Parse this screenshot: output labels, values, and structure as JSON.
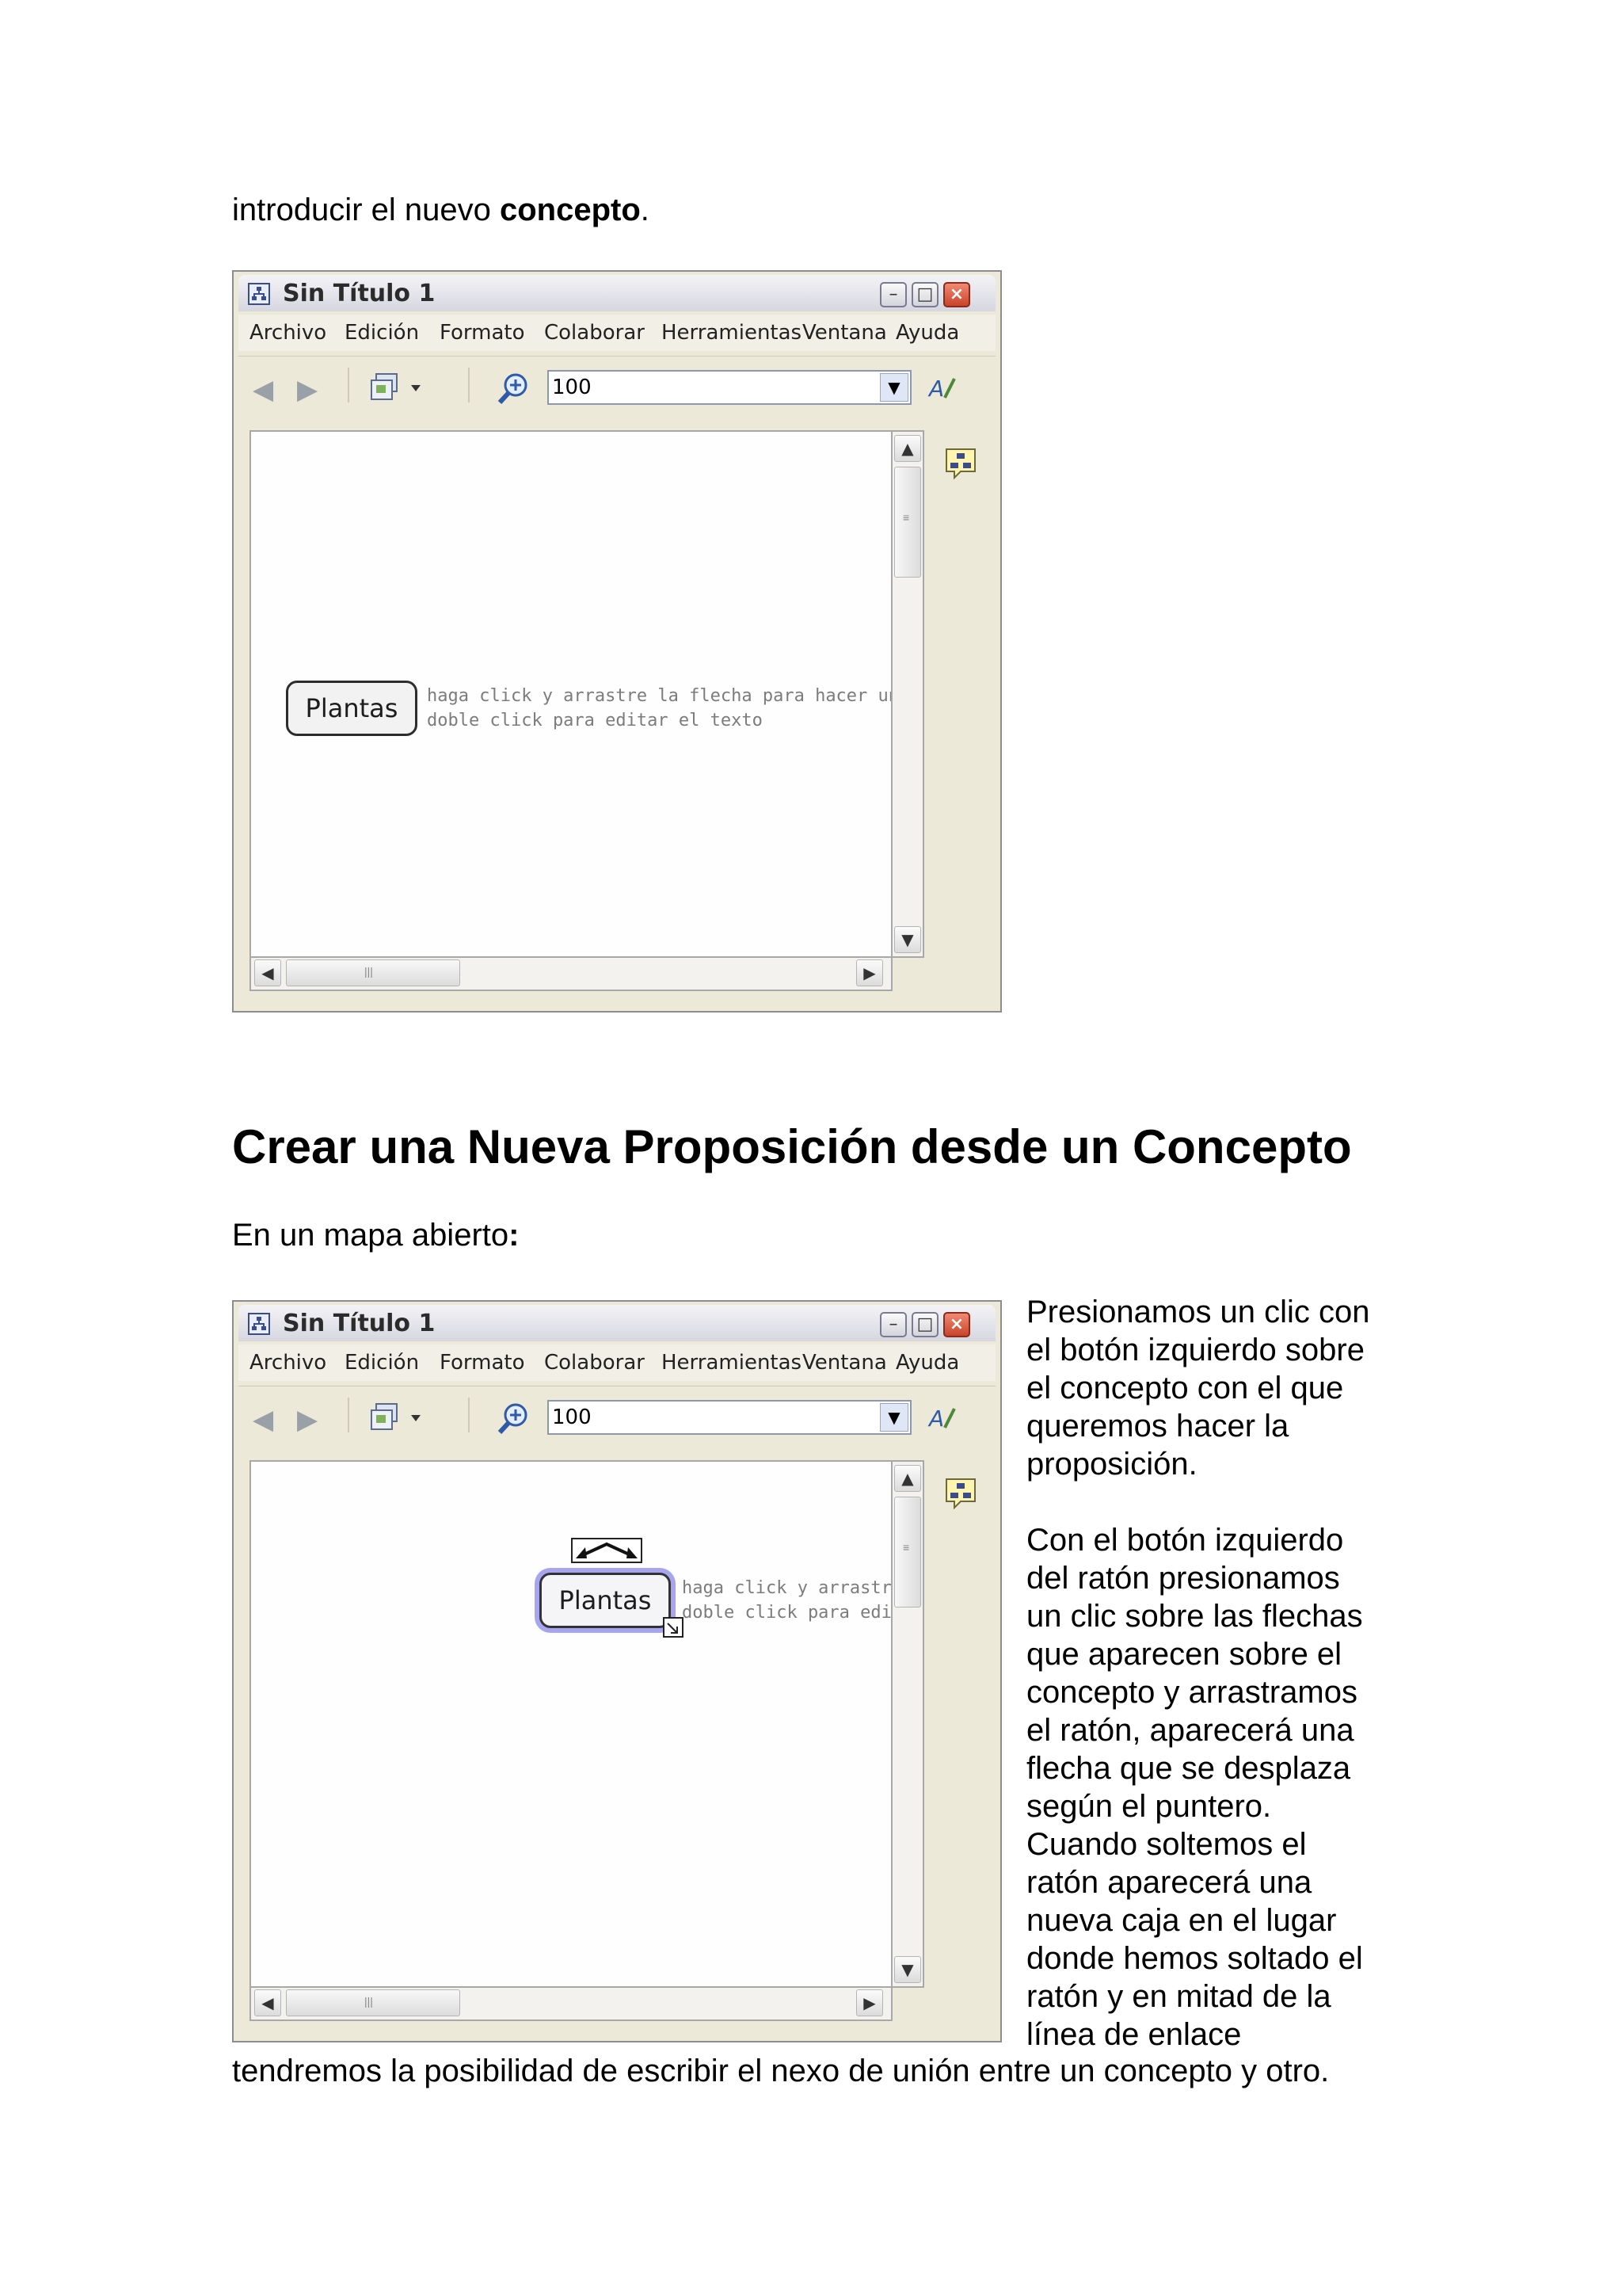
{
  "intro": {
    "text_before": "introducir el nuevo ",
    "bold": "concepto",
    "text_after": "."
  },
  "heading": "Crear una Nueva Proposición desde un Concepto",
  "subheading": {
    "text": "En un mapa abierto",
    "bold_colon": ":"
  },
  "window": {
    "title": "Sin Título 1",
    "menu": [
      "Archivo",
      "Edición",
      "Formato",
      "Colaborar",
      "Herramientas",
      "Ventana",
      "Ayuda"
    ],
    "zoom_value": "100",
    "concept_label": "Plantas",
    "hint_line1_a": "haga click y arrastre la flecha para hacer un en",
    "hint_line2_a": "doble click para editar el texto",
    "hint_line1_b": "haga click y arrastre l",
    "hint_line2_b": "doble click para edita"
  },
  "side_text": [
    "Presionamos un clic con",
    "el botón izquierdo sobre",
    "el concepto con el que",
    "queremos hacer la",
    "proposición.",
    "",
    "Con el botón izquierdo",
    "del ratón presionamos",
    "un clic sobre las flechas",
    "que aparecen sobre el",
    "concepto y arrastramos",
    "el ratón, aparecerá una",
    "flecha que se desplaza",
    "según el puntero.",
    "Cuando soltemos el",
    "ratón aparecerá una",
    "nueva caja en el lugar",
    "donde hemos soltado el",
    "ratón y en mitad de la",
    "línea de enlace"
  ],
  "closing_line": "tendremos la posibilidad de escribir el nexo de unión entre un concepto y otro.",
  "icons": [
    "app-map-icon",
    "minimize-icon",
    "maximize-icon",
    "close-icon",
    "back-arrow-icon",
    "forward-arrow-icon",
    "view-dropdown-icon",
    "zoom-icon",
    "style-palette-icon",
    "collaboration-icon",
    "resize-handle-icon",
    "drag-arrows-icon"
  ]
}
